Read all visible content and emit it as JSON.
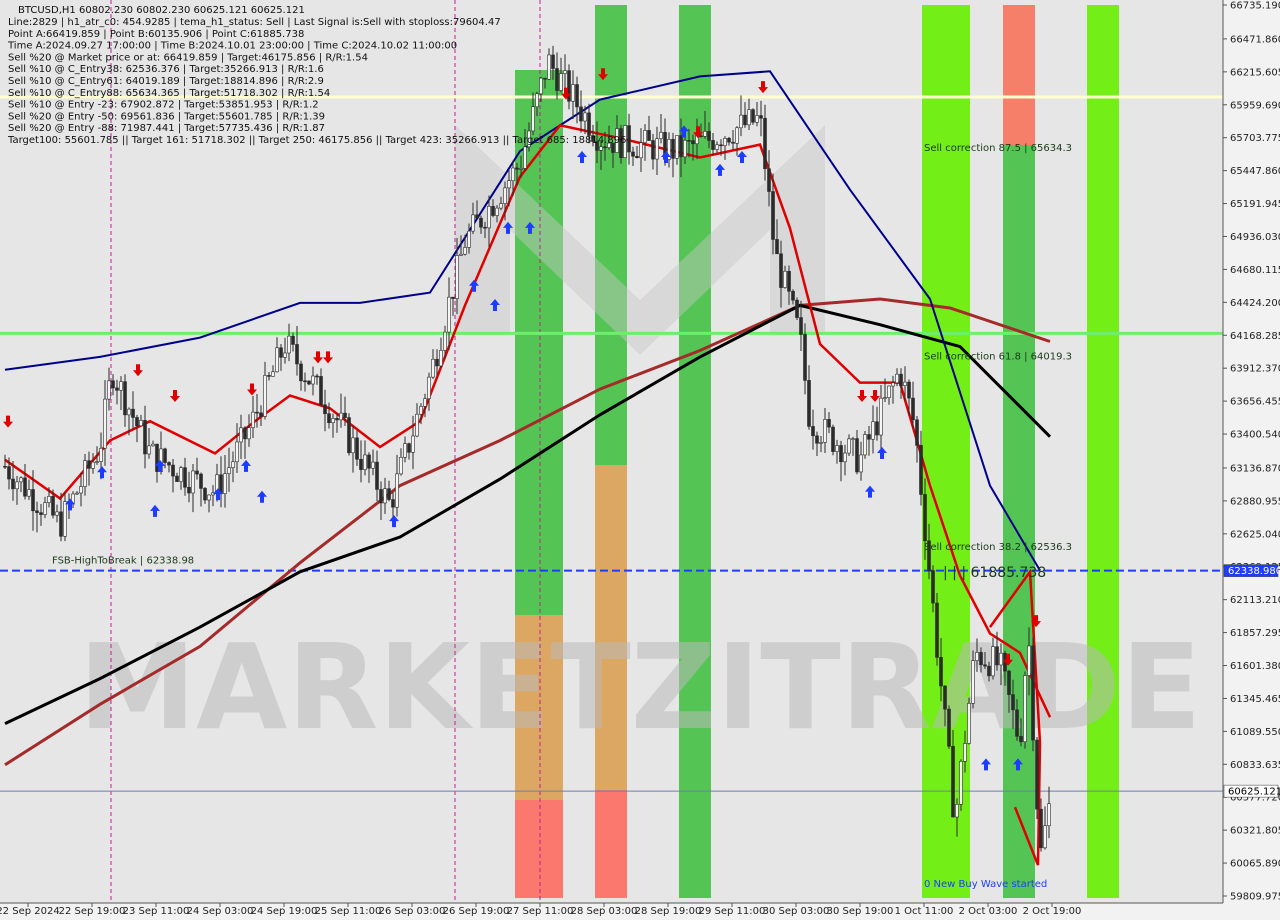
{
  "chart_data": {
    "type": "candlestick",
    "symbol_line": "BTCUSD,H1  60802.230 60802.230 60625.121 60625.121",
    "info_lines": [
      "Line:2829  |  h1_atr_c0: 454.9285  |  tema_h1_status: Sell  |  Last Signal is:Sell with stoploss:79604.47",
      "Point A:66419.859  |  Point B:60135.906  |  Point C:61885.738",
      "Time A:2024.09.27 17:00:00  |  Time B:2024.10.01 23:00:00  |  Time C:2024.10.02 11:00:00",
      "Sell %20 @ Market price or at: 66419.859  |  Target:46175.856  |  R/R:1.54",
      "Sell %10 @ C_Entry38: 62536.376  |  Target:35266.913  |  R/R:1.6",
      "Sell %10 @ C_Entry61: 64019.189  |  Target:18814.896  |  R/R:2.9",
      "Sell %10 @ C_Entry88: 65634.365  |  Target:51718.302  |  R/R:1.54",
      "Sell %10 @ Entry -23: 67902.872  |  Target:53851.953  |  R/R:1.2",
      "Sell %20 @ Entry -50: 69561.836  |  Target:55601.785  |  R/R:1.39",
      "Sell %20 @ Entry -88: 71987.441  |  Target:57735.436  |  R/R:1.87",
      "Target100: 55601.785  ||  Target 161: 51718.302  ||  Target 250: 46175.856  ||  Target 423: 35266.913  ||  Target 685: 18814.896"
    ],
    "y_ticks": [
      "66735.190",
      "66471.860",
      "66215.605",
      "65959.690",
      "65703.775",
      "65447.860",
      "65191.945",
      "64936.030",
      "64680.115",
      "64424.200",
      "64168.285",
      "63912.370",
      "63656.455",
      "63400.540",
      "63136.870",
      "62880.955",
      "62625.040",
      "62369.125",
      "62113.210",
      "61857.295",
      "61601.380",
      "61345.465",
      "61089.550",
      "60833.635",
      "60577.720",
      "60321.805",
      "60065.890",
      "59809.975"
    ],
    "y_range": [
      59809.975,
      66735.19
    ],
    "x_labels": [
      "22 Sep 2024",
      "22 Sep 19:00",
      "23 Sep 11:00",
      "24 Sep 03:00",
      "24 Sep 19:00",
      "25 Sep 11:00",
      "26 Sep 03:00",
      "26 Sep 19:00",
      "27 Sep 11:00",
      "28 Sep 03:00",
      "28 Sep 19:00",
      "29 Sep 11:00",
      "30 Sep 03:00",
      "30 Sep 19:00",
      "1 Oct 11:00",
      "2 Oct 03:00",
      "2 Oct 19:00"
    ],
    "price_tags": [
      {
        "value": 62338.98,
        "label": "62338.980",
        "color": "#1e3cff"
      },
      {
        "value": 60625.121,
        "label": "60625.121",
        "color": "#ffffff"
      }
    ],
    "horizontal_levels": [
      {
        "name": "level-green",
        "value": 64183.0,
        "color": "#6cf06c"
      },
      {
        "name": "level-yellow",
        "value": 66020.0,
        "color": "#ffffd0"
      },
      {
        "name": "level-blue-dashed",
        "value": 62338.98,
        "color": "#1e3cff"
      },
      {
        "name": "level-current",
        "value": 60625.121,
        "color": "#6a7fb0"
      }
    ],
    "annotations": [
      {
        "text": "FSB-HighToBreak  |  62338.98",
        "x": "22 Sep 19:00",
        "y": 62395.0
      },
      {
        "text": "Sell correction 87.5 | 65634.3",
        "x": "1 Oct 11:00",
        "y": 65600.0
      },
      {
        "text": "Sell correction 61.8 | 64019.3",
        "x": "1 Oct 11:00",
        "y": 63980.0
      },
      {
        "text": "Sell correction 38.2 | 62536.3",
        "x": "1 Oct 11:00",
        "y": 62500.0
      },
      {
        "text": "| | | 61885.738",
        "x": "2 Oct 03:00",
        "y": 62290.0
      },
      {
        "text": "0 New Buy Wave started",
        "x": "1 Oct 11:00",
        "y": 59880.0
      }
    ],
    "watermark": "MARKETZITRADE",
    "colors": {
      "background": "#e6e6e6",
      "bull": "#2b2b2b",
      "bear": "#2b2b2b",
      "ema_fast": "#e00000",
      "ma_blue": "#00008b",
      "ma_black": "#000000",
      "ma_brown": "#a52a2a"
    },
    "grid": false
  }
}
